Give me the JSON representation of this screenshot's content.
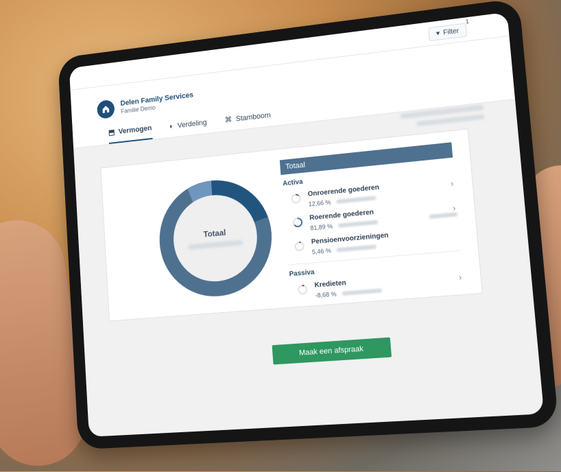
{
  "header": {
    "filter_label": "Filter",
    "filter_badge": "1",
    "brand": {
      "name": "Delen Family Services",
      "subtitle": "Familie Demo"
    },
    "tabs": [
      {
        "label": "Vermogen",
        "icon": "asset-icon",
        "active": true
      },
      {
        "label": "Verdeling",
        "icon": "pie-icon",
        "active": false
      },
      {
        "label": "Stamboom",
        "icon": "tree-icon",
        "active": false
      }
    ]
  },
  "colors": {
    "primary": "#1f4f79",
    "ring_main": "#4f7190",
    "ring_dark": "#21557f",
    "ring_light": "#6f96bd",
    "ring_accent": "#a91d3a",
    "cta": "#2f9760"
  },
  "chart": {
    "label": "Totaal"
  },
  "panel": {
    "title": "Totaal",
    "activa_title": "Activa",
    "passiva_title": "Passiva",
    "activa_items": [
      {
        "name": "Onroerende goederen",
        "pct": "12,66 %"
      },
      {
        "name": "Roerende goederen",
        "pct": "81,89 %"
      },
      {
        "name": "Pensioenvoorzieningen",
        "pct": "5,46 %"
      }
    ],
    "passiva_items": [
      {
        "name": "Kredieten",
        "pct": "-8,68 %"
      }
    ]
  },
  "cta_label": "Maak een afspraak"
}
